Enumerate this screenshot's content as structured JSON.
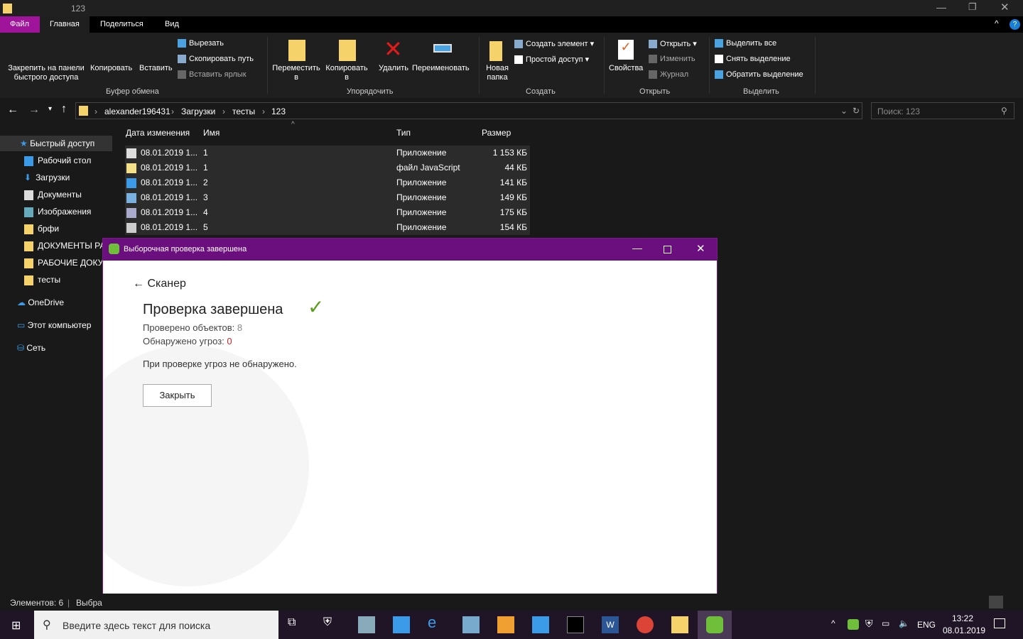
{
  "window": {
    "title": "123"
  },
  "tabs": [
    "Файл",
    "Главная",
    "Поделиться",
    "Вид"
  ],
  "ribbon": {
    "pin": "Закрепить на панели быстрого доступа",
    "copy": "Копировать",
    "paste": "Вставить",
    "cut": "Вырезать",
    "copy_path": "Скопировать путь",
    "paste_shortcut": "Вставить ярлык",
    "group_clipboard": "Буфер обмена",
    "move_to": "Переместить в",
    "copy_to": "Копировать в",
    "delete": "Удалить",
    "rename": "Переименовать",
    "group_organize": "Упорядочить",
    "new_folder": "Новая папка",
    "new_item": "Создать элемент",
    "easy_access": "Простой доступ",
    "group_create": "Создать",
    "properties": "Свойства",
    "open": "Открыть",
    "edit": "Изменить",
    "history": "Журнал",
    "group_open": "Открыть",
    "select_all": "Выделить все",
    "select_none": "Снять выделение",
    "invert": "Обратить выделение",
    "group_select": "Выделить"
  },
  "address": {
    "crumbs": [
      "alexander196431",
      "Загрузки",
      "тесты",
      "123"
    ],
    "search_placeholder": "Поиск: 123"
  },
  "sidebar": [
    "Быстрый доступ",
    "Рабочий стол",
    "Загрузки",
    "Документы",
    "Изображения",
    "брфи",
    "ДОКУМЕНТЫ РА",
    "РАБОЧИЕ ДОКУ",
    "тесты",
    "OneDrive",
    "Этот компьютер",
    "Сеть"
  ],
  "columns": [
    "Дата изменения",
    "Имя",
    "Тип",
    "Размер"
  ],
  "files": [
    {
      "date": "08.01.2019 1...",
      "name": "1",
      "type": "Приложение",
      "size": "1 153 КБ"
    },
    {
      "date": "08.01.2019 1...",
      "name": "1",
      "type": "файл JavaScript",
      "size": "44 КБ"
    },
    {
      "date": "08.01.2019 1...",
      "name": "2",
      "type": "Приложение",
      "size": "141 КБ"
    },
    {
      "date": "08.01.2019 1...",
      "name": "3",
      "type": "Приложение",
      "size": "149 КБ"
    },
    {
      "date": "08.01.2019 1...",
      "name": "4",
      "type": "Приложение",
      "size": "175 КБ"
    },
    {
      "date": "08.01.2019 1...",
      "name": "5",
      "type": "Приложение",
      "size": "154 КБ"
    }
  ],
  "status": {
    "items": "Элементов: 6",
    "selected": "Выбра"
  },
  "dialog": {
    "title": "Выборочная проверка завершена",
    "back": "Сканер",
    "heading": "Проверка завершена",
    "checked_label": "Проверено объектов: ",
    "checked": "8",
    "threats_label": "Обнаружено угроз: ",
    "threats": "0",
    "message": "При проверке угроз не обнаружено.",
    "close": "Закрыть"
  },
  "taskbar": {
    "search_placeholder": "Введите здесь текст для поиска",
    "lang": "ENG",
    "time": "13:22",
    "date": "08.01.2019"
  },
  "colors": {
    "accent": "#6c0f7e",
    "check": "#5a9e1e",
    "threat": "#e02020"
  }
}
